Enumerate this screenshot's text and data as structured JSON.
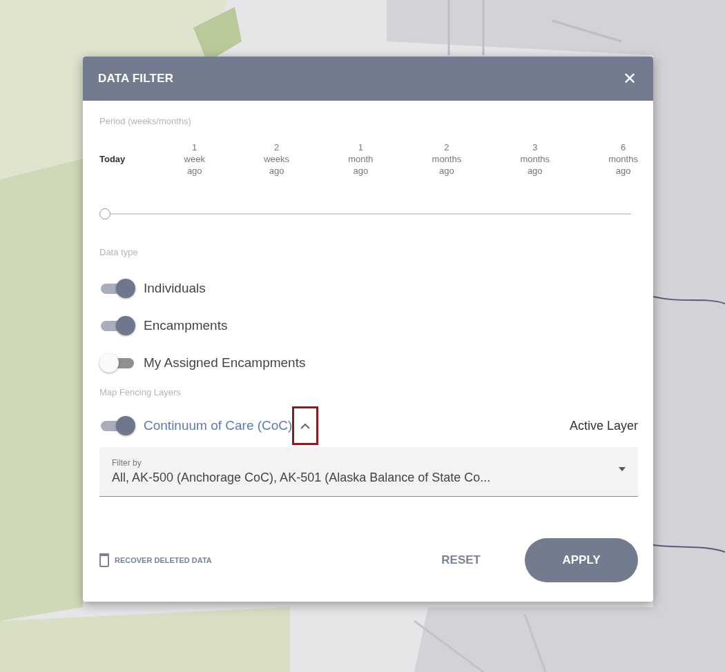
{
  "dialog": {
    "title": "DATA FILTER",
    "close_icon": "✕",
    "period": {
      "label": "Period (weeks/months)",
      "level": 0,
      "options": [
        {
          "label": "Today",
          "selected": true
        },
        {
          "label": "1 week ago",
          "selected": false
        },
        {
          "label": "2 weeks ago",
          "selected": false
        },
        {
          "label": "1 month ago",
          "selected": false
        },
        {
          "label": "2 months ago",
          "selected": false
        },
        {
          "label": "3 months ago",
          "selected": false
        },
        {
          "label": "6 months ago",
          "selected": false
        }
      ]
    },
    "data_type": {
      "label": "Data type",
      "toggles": [
        {
          "label": "Individuals",
          "on": true
        },
        {
          "label": "Encampments",
          "on": true
        },
        {
          "label": "My Assigned Encampments",
          "on": false
        }
      ]
    },
    "fencing": {
      "label": "Map Fencing Layers",
      "layer": {
        "label": "Continuum of Care (CoC)",
        "on": true,
        "expanded": true,
        "highlighted": true,
        "status": "Active Layer"
      },
      "filter": {
        "label": "Filter by",
        "value": "All, AK-500 (Anchorage CoC), AK-501 (Alaska Balance of State Co..."
      }
    },
    "footer": {
      "recover": "RECOVER DELETED DATA",
      "reset": "RESET",
      "apply": "APPLY"
    }
  }
}
